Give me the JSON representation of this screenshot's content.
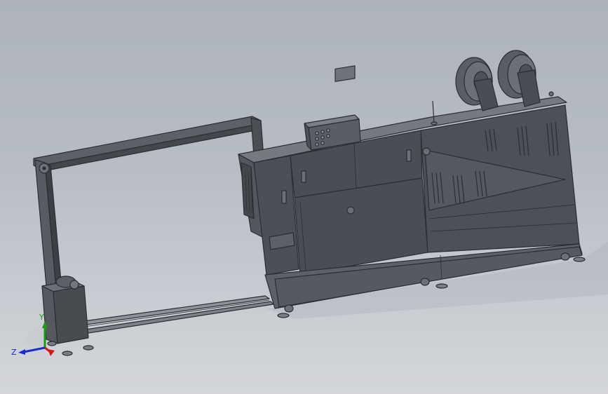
{
  "colors": {
    "background_top": "#aeb3bb",
    "background_bottom": "#d4d6da",
    "body_face": "#4a4d53",
    "body_side": "#3d4045",
    "body_top": "#6b6f76",
    "frame": "#5a5d63",
    "outline": "#2b2d31",
    "axis_x": "#d01818",
    "axis_y": "#1a9a1a",
    "axis_z": "#1a2bd0"
  },
  "triad": {
    "y_label": "Y",
    "z_label": "Z"
  }
}
